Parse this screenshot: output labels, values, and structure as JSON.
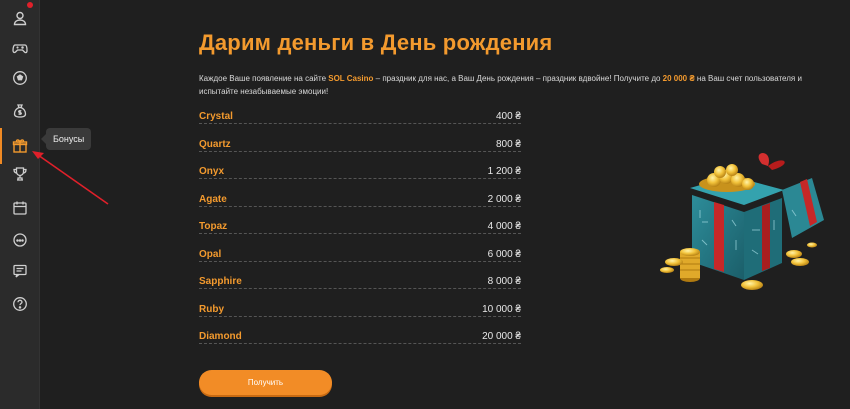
{
  "sidebar": {
    "items": [
      {
        "id": "profile",
        "icon": "user-icon"
      },
      {
        "id": "games",
        "icon": "gamepad-icon"
      },
      {
        "id": "sport",
        "icon": "soccer-ball-icon"
      },
      {
        "id": "money",
        "icon": "money-bag-icon"
      },
      {
        "id": "bonuses",
        "icon": "gift-icon",
        "active": true
      },
      {
        "id": "tournaments",
        "icon": "trophy-icon"
      },
      {
        "id": "calendar",
        "icon": "calendar-icon"
      },
      {
        "id": "chat",
        "icon": "chat-bubble-icon"
      },
      {
        "id": "news",
        "icon": "news-icon"
      },
      {
        "id": "help",
        "icon": "help-icon"
      }
    ],
    "tooltip": "Бонусы"
  },
  "page": {
    "title": "Дарим деньги в День рождения",
    "intro_1": "Каждое Ваше появление на сайте ",
    "intro_brand": "SOL Casino",
    "intro_2": " – праздник для нас, а Ваш День рождения – праздник вдвойне! Получите до ",
    "intro_amount": "20 000 ₴",
    "intro_3": " на Ваш счет пользователя и испытайте незабываемые эмоции!"
  },
  "levels": [
    {
      "name": "Crystal",
      "amount": "400 ₴"
    },
    {
      "name": "Quartz",
      "amount": "800 ₴"
    },
    {
      "name": "Onyx",
      "amount": "1 200 ₴"
    },
    {
      "name": "Agate",
      "amount": "2 000 ₴"
    },
    {
      "name": "Topaz",
      "amount": "4 000 ₴"
    },
    {
      "name": "Opal",
      "amount": "6 000 ₴"
    },
    {
      "name": "Sapphire",
      "amount": "8 000 ₴"
    },
    {
      "name": "Ruby",
      "amount": "10 000 ₴"
    },
    {
      "name": "Diamond",
      "amount": "20 000 ₴"
    }
  ],
  "cta": {
    "label": "Получить"
  },
  "colors": {
    "accent": "#f39a2e",
    "button": "#f28c26",
    "background": "#1f1f1f",
    "sidebar": "#2b2b2b",
    "annotation": "#e0202a"
  }
}
